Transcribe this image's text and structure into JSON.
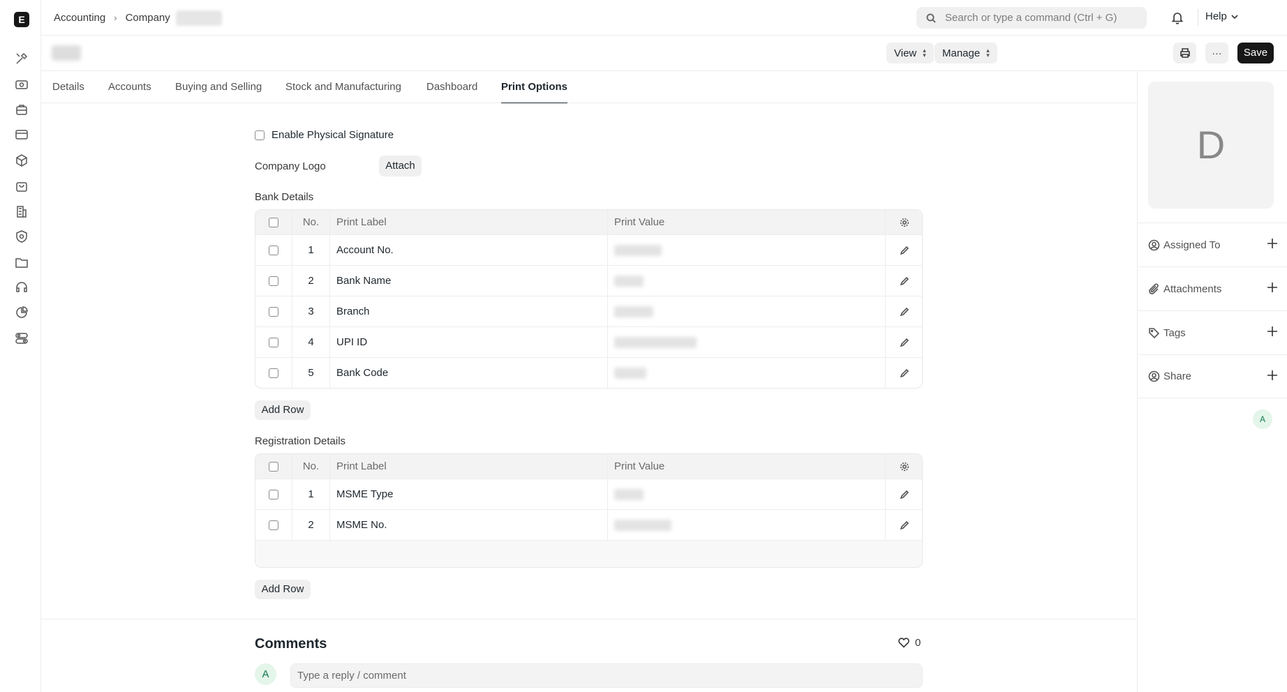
{
  "breadcrumb": {
    "items": [
      "Accounting",
      "Company"
    ]
  },
  "search": {
    "placeholder": "Search or type a command (Ctrl + G)"
  },
  "user": {
    "initial": "A"
  },
  "help_label": "Help",
  "toolbar": {
    "view_label": "View",
    "manage_label": "Manage",
    "more_label": "···",
    "save_label": "Save"
  },
  "tabs": [
    {
      "label": "Details",
      "active": false
    },
    {
      "label": "Accounts",
      "active": false
    },
    {
      "label": "Buying and Selling",
      "active": false
    },
    {
      "label": "Stock and Manufacturing",
      "active": false
    },
    {
      "label": "Dashboard",
      "active": false
    },
    {
      "label": "Print Options",
      "active": true
    }
  ],
  "form": {
    "enable_physical_signature": {
      "label": "Enable Physical Signature",
      "checked": false
    },
    "company_logo": {
      "label": "Company Logo",
      "attach_label": "Attach"
    },
    "bank_details": {
      "label": "Bank Details",
      "columns": [
        "No.",
        "Print Label",
        "Print Value"
      ],
      "rows": [
        {
          "no": "1",
          "label": "Account No."
        },
        {
          "no": "2",
          "label": "Bank Name"
        },
        {
          "no": "3",
          "label": "Branch"
        },
        {
          "no": "4",
          "label": "UPI ID"
        },
        {
          "no": "5",
          "label": "Bank Code"
        }
      ],
      "add_row_label": "Add Row"
    },
    "registration_details": {
      "label": "Registration Details",
      "columns": [
        "No.",
        "Print Label",
        "Print Value"
      ],
      "rows": [
        {
          "no": "1",
          "label": "MSME Type"
        },
        {
          "no": "2",
          "label": "MSME No."
        }
      ],
      "add_row_label": "Add Row"
    }
  },
  "sidebar": {
    "image_initial": "D",
    "items": [
      {
        "label": "Assigned To",
        "icon": "assign-icon"
      },
      {
        "label": "Attachments",
        "icon": "paperclip-icon"
      },
      {
        "label": "Tags",
        "icon": "tag-icon"
      },
      {
        "label": "Share",
        "icon": "share-icon"
      }
    ],
    "viewer_initial": "A"
  },
  "comments": {
    "title": "Comments",
    "likes": "0",
    "placeholder": "Type a reply / comment"
  },
  "colors": {
    "primary_button": "#171717",
    "avatar_bg": "#e4f5e9",
    "avatar_fg": "#16794c"
  }
}
